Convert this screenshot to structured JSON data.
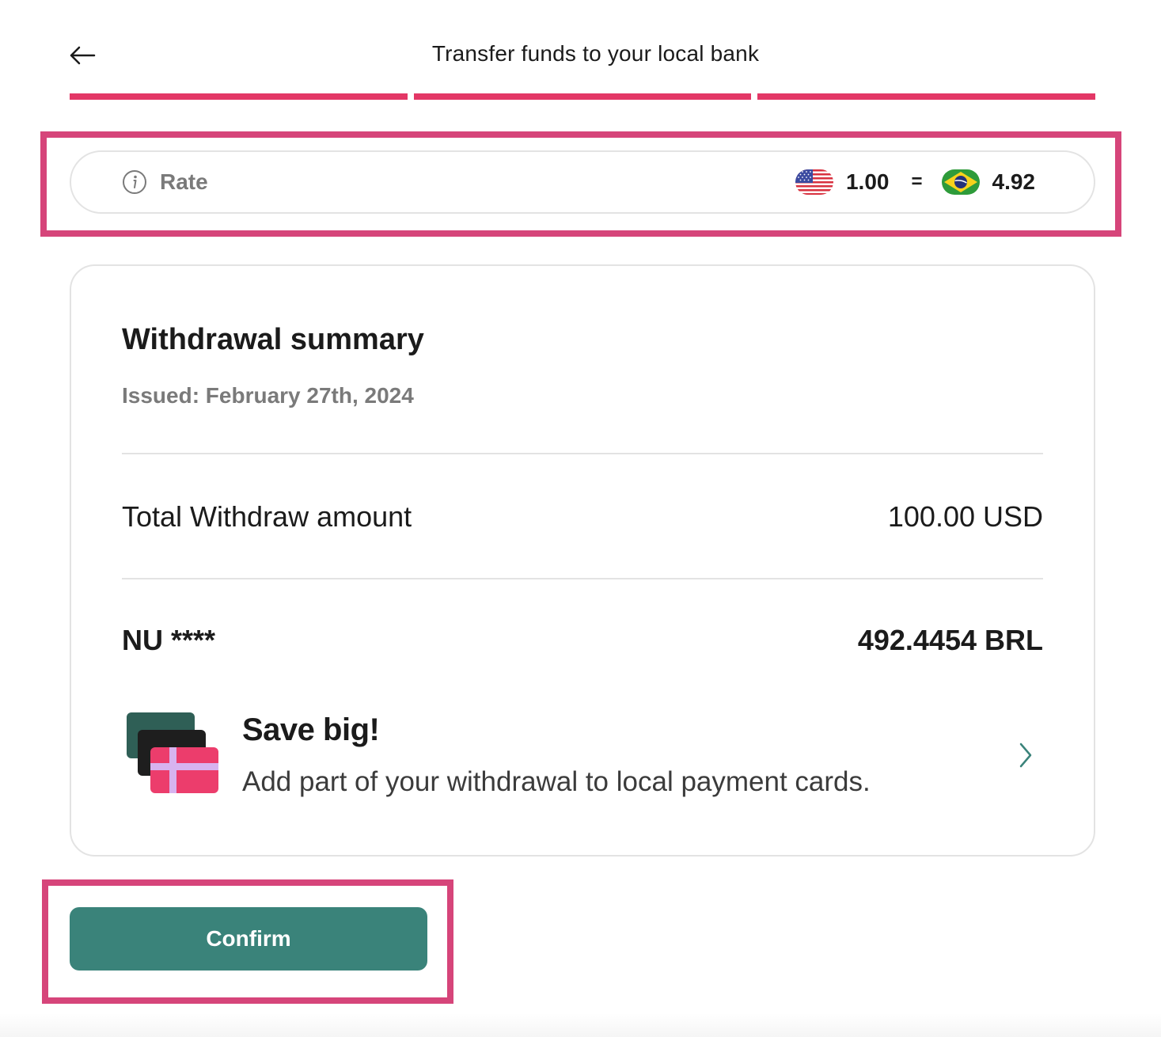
{
  "header": {
    "title": "Transfer funds to your local bank",
    "back_icon": "arrow-left-icon"
  },
  "stepper": {
    "steps_total": 3,
    "steps_completed": 3,
    "active_color": "#e33766"
  },
  "rate": {
    "label": "Rate",
    "info_icon": "info-icon",
    "from_flag": "us-flag-icon",
    "from_amount": "1.00",
    "equals": "=",
    "to_flag": "brazil-flag-icon",
    "to_amount": "4.92"
  },
  "summary": {
    "title": "Withdrawal summary",
    "issued": "Issued: February 27th, 2024",
    "total_label": "Total Withdraw amount",
    "total_value": "100.00 USD",
    "account_label": "NU ****",
    "account_value": "492.4454 BRL"
  },
  "promo": {
    "title": "Save big!",
    "subtitle": "Add part of your withdrawal to local payment cards.",
    "art_icon": "payment-cards-icon",
    "chevron_icon": "chevron-right-icon"
  },
  "actions": {
    "confirm_label": "Confirm",
    "confirm_color": "#3a837a"
  },
  "colors": {
    "highlight": "#d6457a",
    "accent": "#e33766",
    "muted_text": "#7a7a7a",
    "border": "#e3e3e3"
  }
}
